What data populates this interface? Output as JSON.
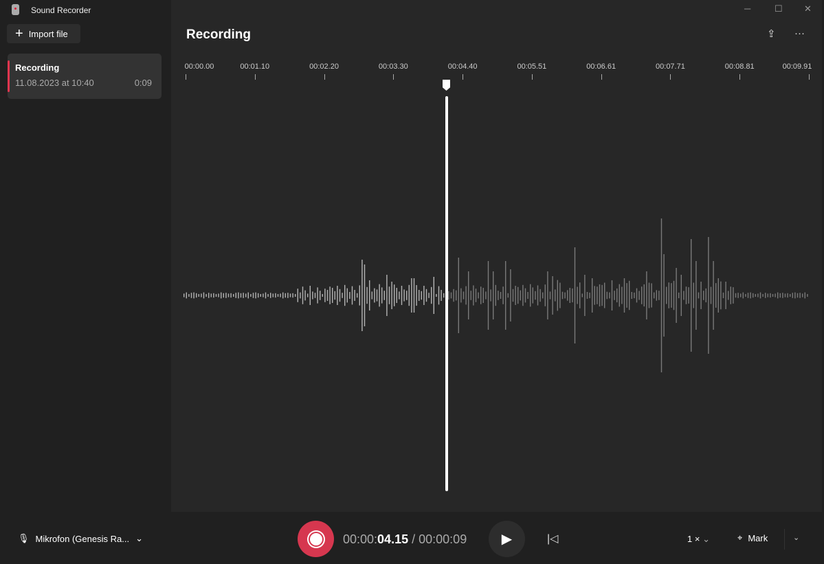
{
  "app": {
    "title": "Sound Recorder",
    "import_label": "Import file"
  },
  "recordings": [
    {
      "name": "Recording",
      "date": "11.08.2023 at 10:40",
      "duration": "0:09",
      "selected": true
    }
  ],
  "main": {
    "title": "Recording",
    "timeline": [
      "00:00.00",
      "00:01.10",
      "00:02.20",
      "00:03.30",
      "00:04.40",
      "00:05.51",
      "00:06.61",
      "00:07.71",
      "00:08.81",
      "00:09.91"
    ],
    "playhead_seconds": 4.15
  },
  "controls": {
    "microphone": "Mikrofon (Genesis Ra...",
    "time_current_prefix": "00:00:",
    "time_current_main": "04.15",
    "time_separator": "/",
    "time_total": "00:00:09",
    "speed": "1 ×",
    "mark_label": "Mark"
  },
  "colors": {
    "accent": "#d6374f"
  }
}
